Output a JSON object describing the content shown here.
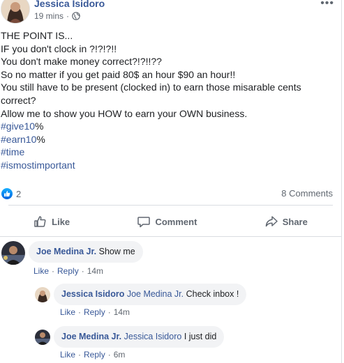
{
  "post": {
    "author": "Jessica Isidoro",
    "time": "19 mins",
    "privacy_icon": "globe-icon",
    "lines": [
      "THE POINT IS...",
      "IF you don't clock in ?!?!?!!",
      "You don't make money correct?!?!!??",
      "So no matter if you get paid 80$ an hour $90 an hour!!",
      "You still have to be present (clocked in) to earn those misarable cents",
      "correct?",
      "Allow me to show you HOW to earn your OWN business."
    ],
    "hashtags": [
      {
        "tag": "#give10",
        "suffix": "%"
      },
      {
        "tag": "#earn10",
        "suffix": "%"
      },
      {
        "tag": "#time",
        "suffix": ""
      },
      {
        "tag": "#ismostimportant",
        "suffix": ""
      }
    ]
  },
  "reactions": {
    "count": "2",
    "comments": "8 Comments"
  },
  "actions": {
    "like": "Like",
    "comment": "Comment",
    "share": "Share"
  },
  "comments": [
    {
      "name": "Joe Medina Jr.",
      "mention": "",
      "text": "Show me",
      "like": "Like",
      "reply": "Reply",
      "time": "14m"
    },
    {
      "name": "Jessica Isidoro",
      "mention": "Joe Medina Jr.",
      "text": "Check inbox !",
      "like": "Like",
      "reply": "Reply",
      "time": "14m"
    },
    {
      "name": "Joe Medina Jr.",
      "mention": "Jessica Isidoro",
      "text": "I just did",
      "like": "Like",
      "reply": "Reply",
      "time": "6m"
    }
  ],
  "colors": {
    "link": "#385898",
    "secondary_text": "#606770",
    "bubble": "#f2f3f5",
    "like_blue": "#1877f2"
  }
}
